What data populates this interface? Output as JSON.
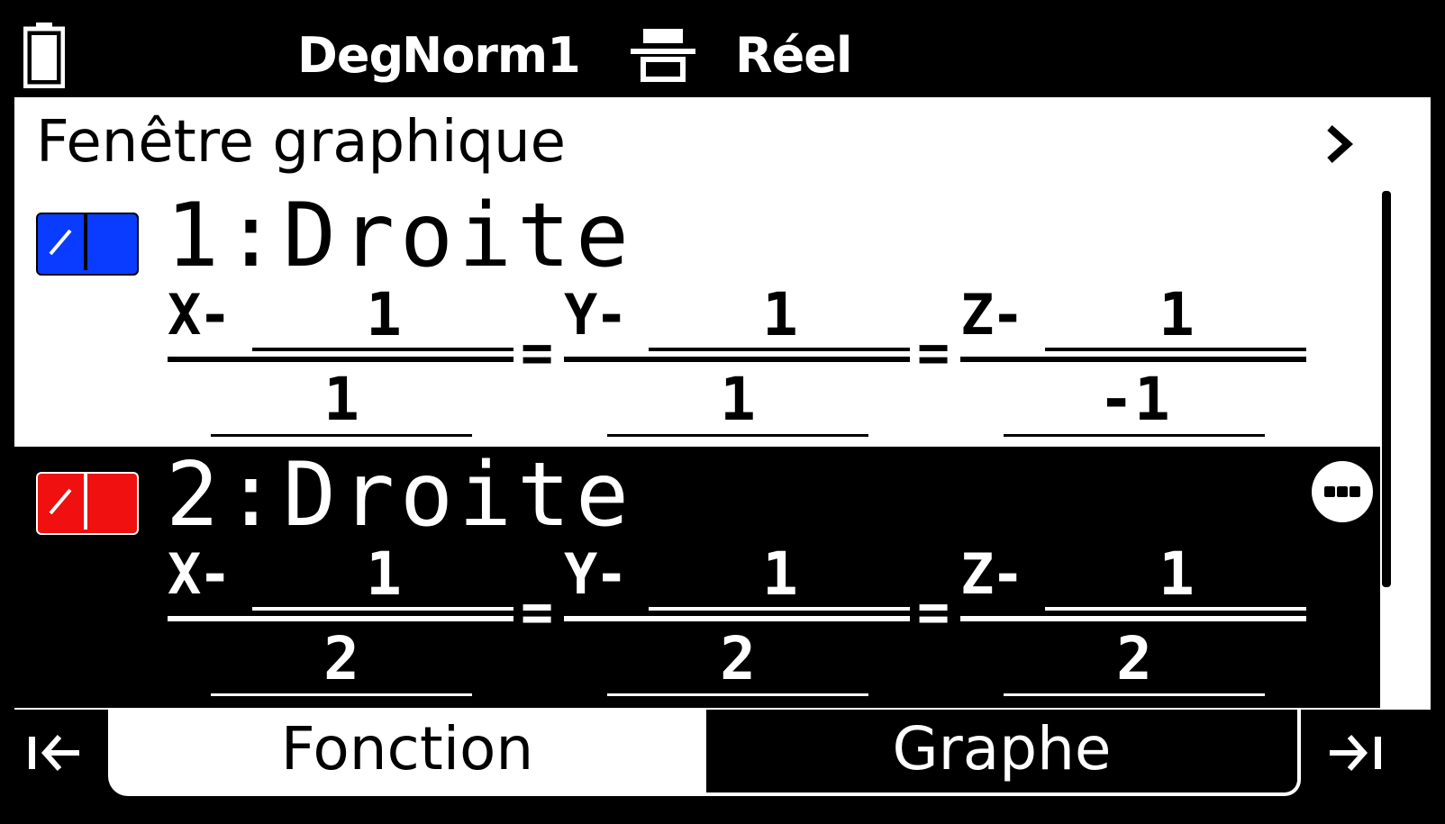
{
  "status_bar": {
    "angle_mode": "Deg",
    "display_mode": "Norm1",
    "complex_mode": "Réel",
    "battery_icon": "battery-icon",
    "input_mode_icon": "math-input-icon"
  },
  "header": {
    "title": "Fenêtre graphique",
    "chevron_icon": "chevron-right-icon"
  },
  "rows": [
    {
      "index": "1",
      "title": "1:Droite",
      "color": "#0a3cff",
      "selected": false,
      "equation": [
        {
          "var": "X",
          "minus": "-",
          "num": "1",
          "den": "1"
        },
        {
          "var": "Y",
          "minus": "-",
          "num": "1",
          "den": "1"
        },
        {
          "var": "Z",
          "minus": "-",
          "num": "1",
          "den": "-1"
        }
      ],
      "equals": "="
    },
    {
      "index": "2",
      "title": "2:Droite",
      "color": "#f01010",
      "selected": true,
      "equation": [
        {
          "var": "X",
          "minus": "-",
          "num": "1",
          "den": "2"
        },
        {
          "var": "Y",
          "minus": "-",
          "num": "1",
          "den": "2"
        },
        {
          "var": "Z",
          "minus": "-",
          "num": "1",
          "den": "2"
        }
      ],
      "equals": "="
    }
  ],
  "tabs": {
    "left_icon": "first-tab-icon",
    "items": [
      {
        "label": "Fonction",
        "active": true
      },
      {
        "label": "Graphe",
        "active": false
      }
    ],
    "right_icon": "last-tab-icon"
  }
}
